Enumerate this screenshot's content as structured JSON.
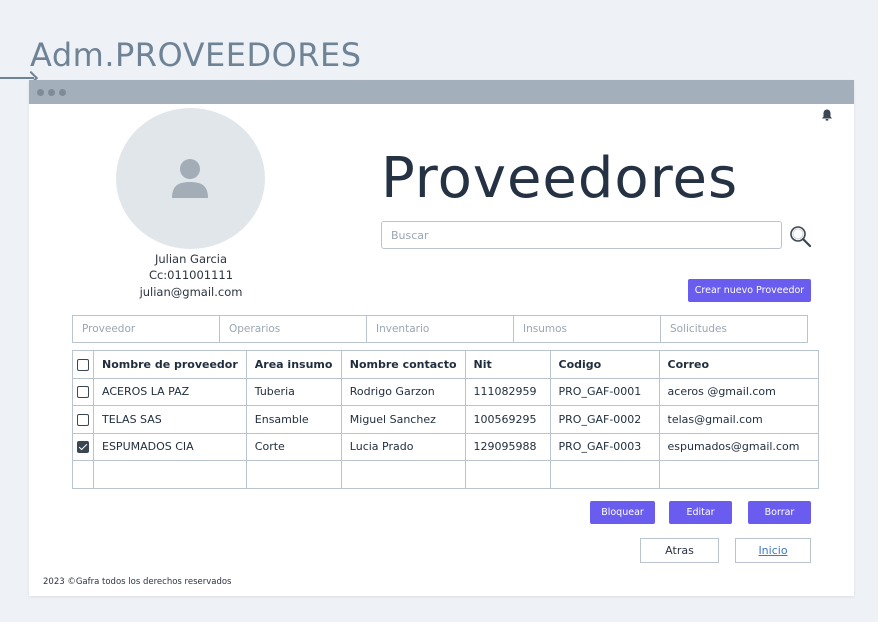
{
  "page_heading": "Adm.PROVEEDORES",
  "user": {
    "name": "Julian Garcia",
    "id": "Cc:011001111",
    "email": "julian@gmail.com"
  },
  "title": "Proveedores",
  "search": {
    "placeholder": "Buscar"
  },
  "create_button": "Crear  nuevo Proveedor",
  "filters": [
    "Proveedor",
    "Operarios",
    "Inventario",
    "Insumos",
    "Solicitudes"
  ],
  "table": {
    "headers": [
      "Nombre de proveedor",
      "Area insumo",
      "Nombre contacto",
      "Nit",
      "Codigo",
      "Correo"
    ],
    "rows": [
      {
        "checked": false,
        "cells": [
          "ACEROS LA PAZ",
          "Tuberia",
          "Rodrigo Garzon",
          "111082959",
          "PRO_GAF-0001",
          "aceros @gmail.com"
        ]
      },
      {
        "checked": false,
        "cells": [
          "TELAS SAS",
          "Ensamble",
          "Miguel Sanchez",
          "100569295",
          "PRO_GAF-0002",
          "telas@gmail.com"
        ]
      },
      {
        "checked": true,
        "cells": [
          "ESPUMADOS CIA",
          "Corte",
          "Lucia Prado",
          "129095988",
          "PRO_GAF-0003",
          "espumados@gmail.com"
        ]
      }
    ]
  },
  "actions": {
    "block": "Bloquear",
    "edit": "Editar",
    "delete": "Borrar"
  },
  "nav": {
    "back": "Atras",
    "home": "Inicio"
  },
  "footer": "2023 ©Gafra todos los derechos reservados",
  "colors": {
    "accent": "#6b5cf0",
    "heading": "#6f8396",
    "titlebar": "#a3afbb"
  },
  "icons": {
    "bell": "bell-icon",
    "search": "search-icon",
    "user": "user-icon"
  }
}
